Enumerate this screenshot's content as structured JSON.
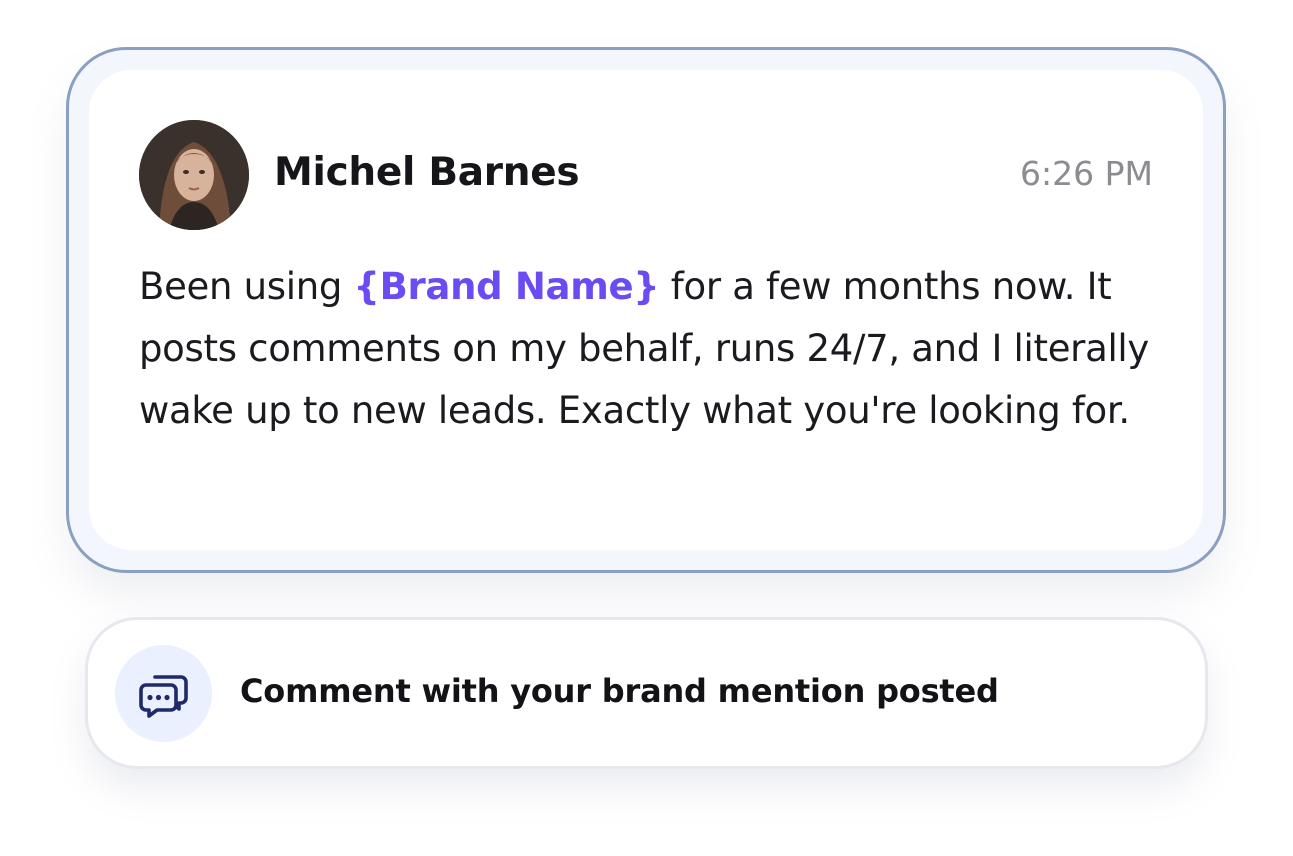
{
  "comment": {
    "author": "Michel Barnes",
    "time": "6:26 PM",
    "body_before": "Been using ",
    "brand_mention": "{Brand Name}",
    "body_after": " for a few months now. It posts comments on my behalf, runs 24/7, and I literally wake up to new leads. Exactly what you're looking for."
  },
  "notification": {
    "icon": "chat-bubbles-icon",
    "text": "Comment with your brand mention posted"
  },
  "colors": {
    "brand_accent": "#6a4cf2",
    "card_border": "#8aa0c0",
    "icon_bg": "#eaf0fd",
    "icon_stroke": "#1f2a6b"
  }
}
